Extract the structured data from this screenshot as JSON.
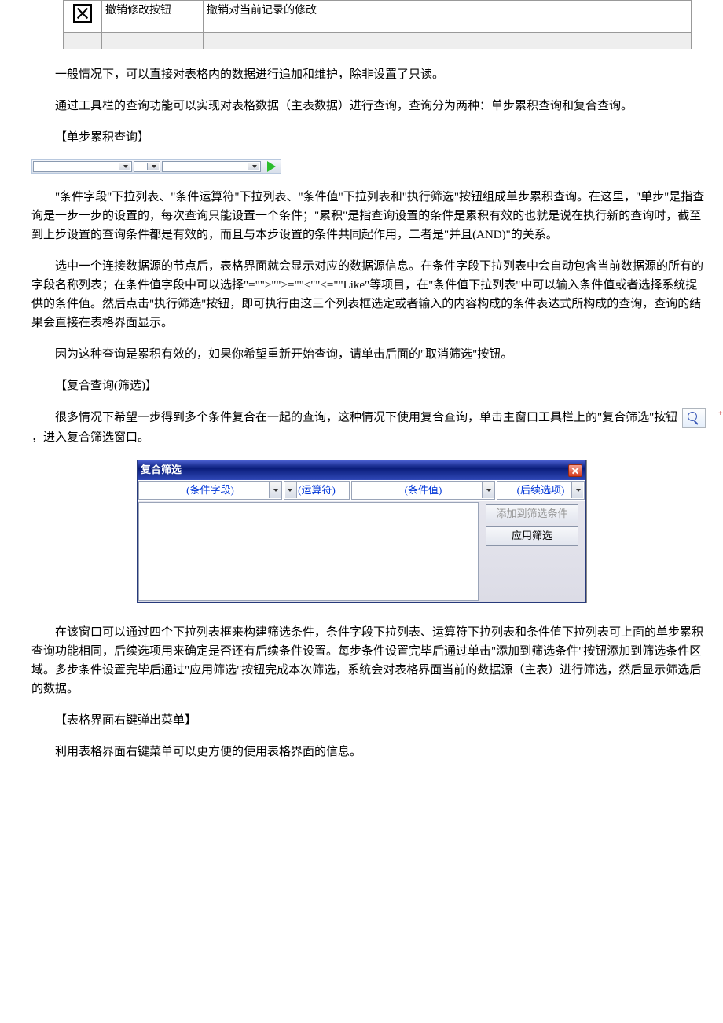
{
  "top_table": {
    "col2": "撤销修改按钮",
    "col3": "撤销对当前记录的修改"
  },
  "p1": "一般情况下，可以直接对表格内的数据进行追加和维护，除非设置了只读。",
  "p2": "通过工具栏的查询功能可以实现对表格数据（主表数据）进行查询，查询分为两种：单步累积查询和复合查询。",
  "h1": "【单步累积查询】",
  "p3": "\"条件字段\"下拉列表、\"条件运算符\"下拉列表、\"条件值\"下拉列表和\"执行筛选\"按钮组成单步累积查询。在这里，\"单步\"是指查询是一步一步的设置的，每次查询只能设置一个条件；\"累积\"是指查询设置的条件是累积有效的也就是说在执行新的查询时，截至到上步设置的查询条件都是有效的，而且与本步设置的条件共同起作用，二者是\"并且(AND)\"的关系。",
  "p4": "选中一个连接数据源的节点后，表格界面就会显示对应的数据源信息。在条件字段下拉列表中会自动包含当前数据源的所有的字段名称列表；在条件值字段中可以选择\"=\"\">\"\">=\"\"<\"\"<=\"\"Like\"等项目，在\"条件值下拉列表\"中可以输入条件值或者选择系统提供的条件值。然后点击\"执行筛选\"按钮，即可执行由这三个列表框选定或者输入的内容构成的条件表达式所构成的查询，查询的结果会直接在表格界面显示。",
  "p5": "因为这种查询是累积有效的，如果你希望重新开始查询，请单击后面的\"取消筛选\"按钮。",
  "h2": "【复合查询(筛选)】",
  "p6a": "很多情况下希望一步得到多个条件复合在一起的查询，这种情况下使用复合查询，单击主窗口工具栏上的\"复合筛选\"按钮",
  "p6b": "，进入复合筛选窗口。",
  "dialog": {
    "title": "复合筛选",
    "field": "(条件字段)",
    "operator": "(运算符)",
    "value": "(条件值)",
    "next": "(后续选项)",
    "btn_add": "添加到筛选条件",
    "btn_apply": "应用筛选"
  },
  "p7": "在该窗口可以通过四个下拉列表框来构建筛选条件，条件字段下拉列表、运算符下拉列表和条件值下拉列表可上面的单步累积查询功能相同，后续选项用来确定是否还有后续条件设置。每步条件设置完毕后通过单击\"添加到筛选条件\"按钮添加到筛选条件区域。多步条件设置完毕后通过\"应用筛选\"按钮完成本次筛选，系统会对表格界面当前的数据源（主表）进行筛选，然后显示筛选后的数据。",
  "h3": "【表格界面右键弹出菜单】",
  "p8": "利用表格界面右键菜单可以更方便的使用表格界面的信息。"
}
